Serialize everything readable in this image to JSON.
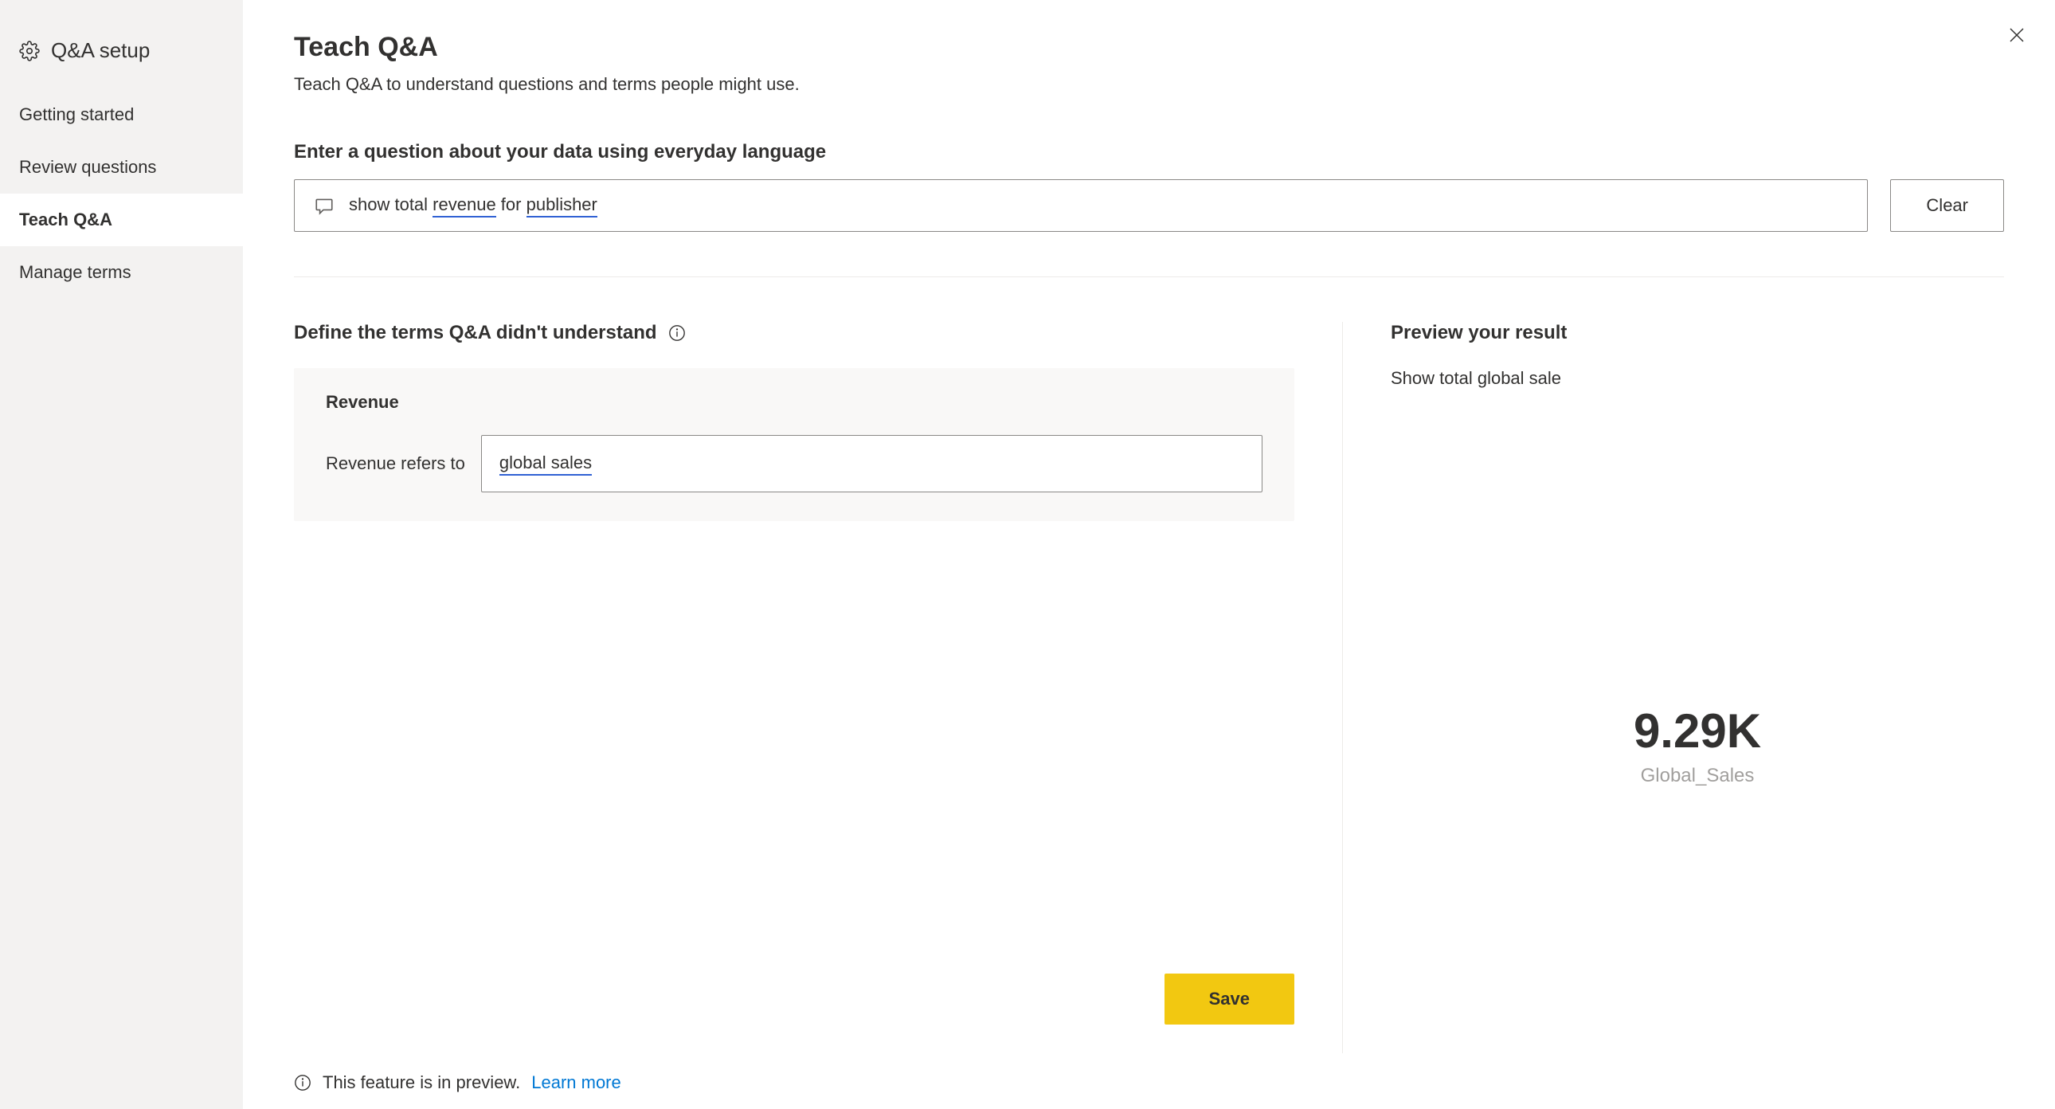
{
  "sidebar": {
    "title": "Q&A setup",
    "items": [
      {
        "label": "Getting started"
      },
      {
        "label": "Review questions"
      },
      {
        "label": "Teach Q&A"
      },
      {
        "label": "Manage terms"
      }
    ]
  },
  "main": {
    "title": "Teach Q&A",
    "subtitle": "Teach Q&A to understand questions and terms people might use.",
    "question_section_label": "Enter a question about your data using everyday language",
    "question_text_parts": {
      "p1": "show total ",
      "p2": "revenue",
      "p3": " for ",
      "p4": "publisher"
    },
    "clear_label": "Clear"
  },
  "define": {
    "heading": "Define the terms Q&A didn't understand",
    "term_title": "Revenue",
    "refers_label": "Revenue refers to",
    "refers_value": "global sales"
  },
  "preview": {
    "heading": "Preview your result",
    "query": "Show total global sale",
    "result_value": "9.29K",
    "result_label": "Global_Sales"
  },
  "save_label": "Save",
  "footer": {
    "text": "This feature is in preview.",
    "link": "Learn more"
  }
}
